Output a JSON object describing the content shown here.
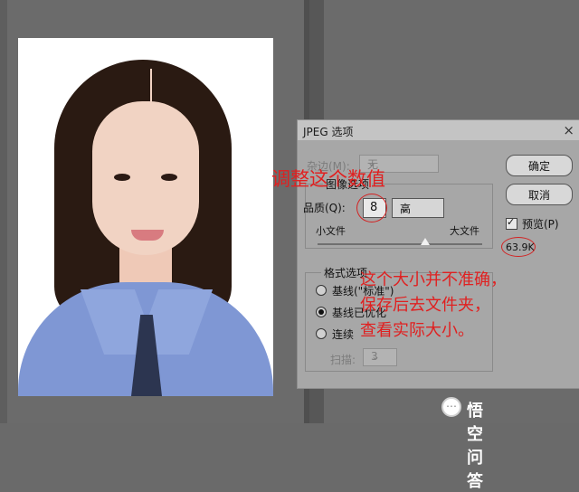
{
  "dialog": {
    "title": "JPEG 选项",
    "close_glyph": "×",
    "matte": {
      "label": "杂边(M):",
      "value": "无"
    },
    "image_options": {
      "title": "图像选项",
      "quality_label": "品质(Q):",
      "quality_value": "8",
      "quality_level": "高",
      "small_file": "小文件",
      "large_file": "大文件",
      "quality_slider_fraction": 0.67
    },
    "format_options": {
      "title": "格式选项",
      "radios": [
        {
          "label": "基线(\"标准\")",
          "selected": false
        },
        {
          "label": "基线已优化",
          "selected": true
        },
        {
          "label": "连续",
          "selected": false
        }
      ],
      "scan_label": "扫描:",
      "scan_value": "3"
    },
    "buttons": {
      "ok": "确定",
      "cancel": "取消"
    },
    "preview": {
      "label": "预览(P)",
      "checked": true
    },
    "file_size": "63.9K"
  },
  "annotations": {
    "title": "调整这个数值",
    "note_lines": [
      "这个大小并不准确，",
      "保存后去文件夹，",
      "查看实际大小。"
    ],
    "color": "#e02020"
  },
  "watermark": {
    "text": "悟空问答"
  },
  "colors": {
    "workspace": "#6b6b6b",
    "dialog_bg": "#a7a7a7",
    "shirt": "#7f97d4",
    "tie": "#2c3550",
    "hair": "#2a1a12"
  },
  "icons": [
    "chevron-down-icon",
    "close-icon",
    "checkbox-checked-icon",
    "slider-thumb-icon",
    "wukong-logo-icon"
  ]
}
